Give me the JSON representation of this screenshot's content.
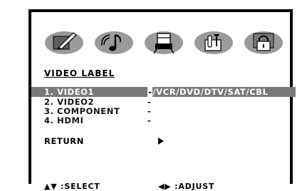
{
  "icons": [
    {
      "name": "picture-icon"
    },
    {
      "name": "sound-icon"
    },
    {
      "name": "setup-icon"
    },
    {
      "name": "tools-icon"
    },
    {
      "name": "lock-icon"
    }
  ],
  "menu": {
    "title": "VIDEO LABEL",
    "items": [
      {
        "label": "1. VIDEO1",
        "value": "/VCR/DVD/DTV/SAT/CBL",
        "cursor": "-"
      },
      {
        "label": "2. VIDEO2",
        "value": "-"
      },
      {
        "label": "3. COMPONENT",
        "value": "-"
      },
      {
        "label": "4. HDMI",
        "value": "-"
      }
    ],
    "return_label": "RETURN"
  },
  "footer": {
    "select": "▲▼ :SELECT",
    "adjust": "◀▶ :ADJUST"
  },
  "colors": {
    "highlight": "#7a7a7a",
    "tab": "#9a9a9a"
  }
}
